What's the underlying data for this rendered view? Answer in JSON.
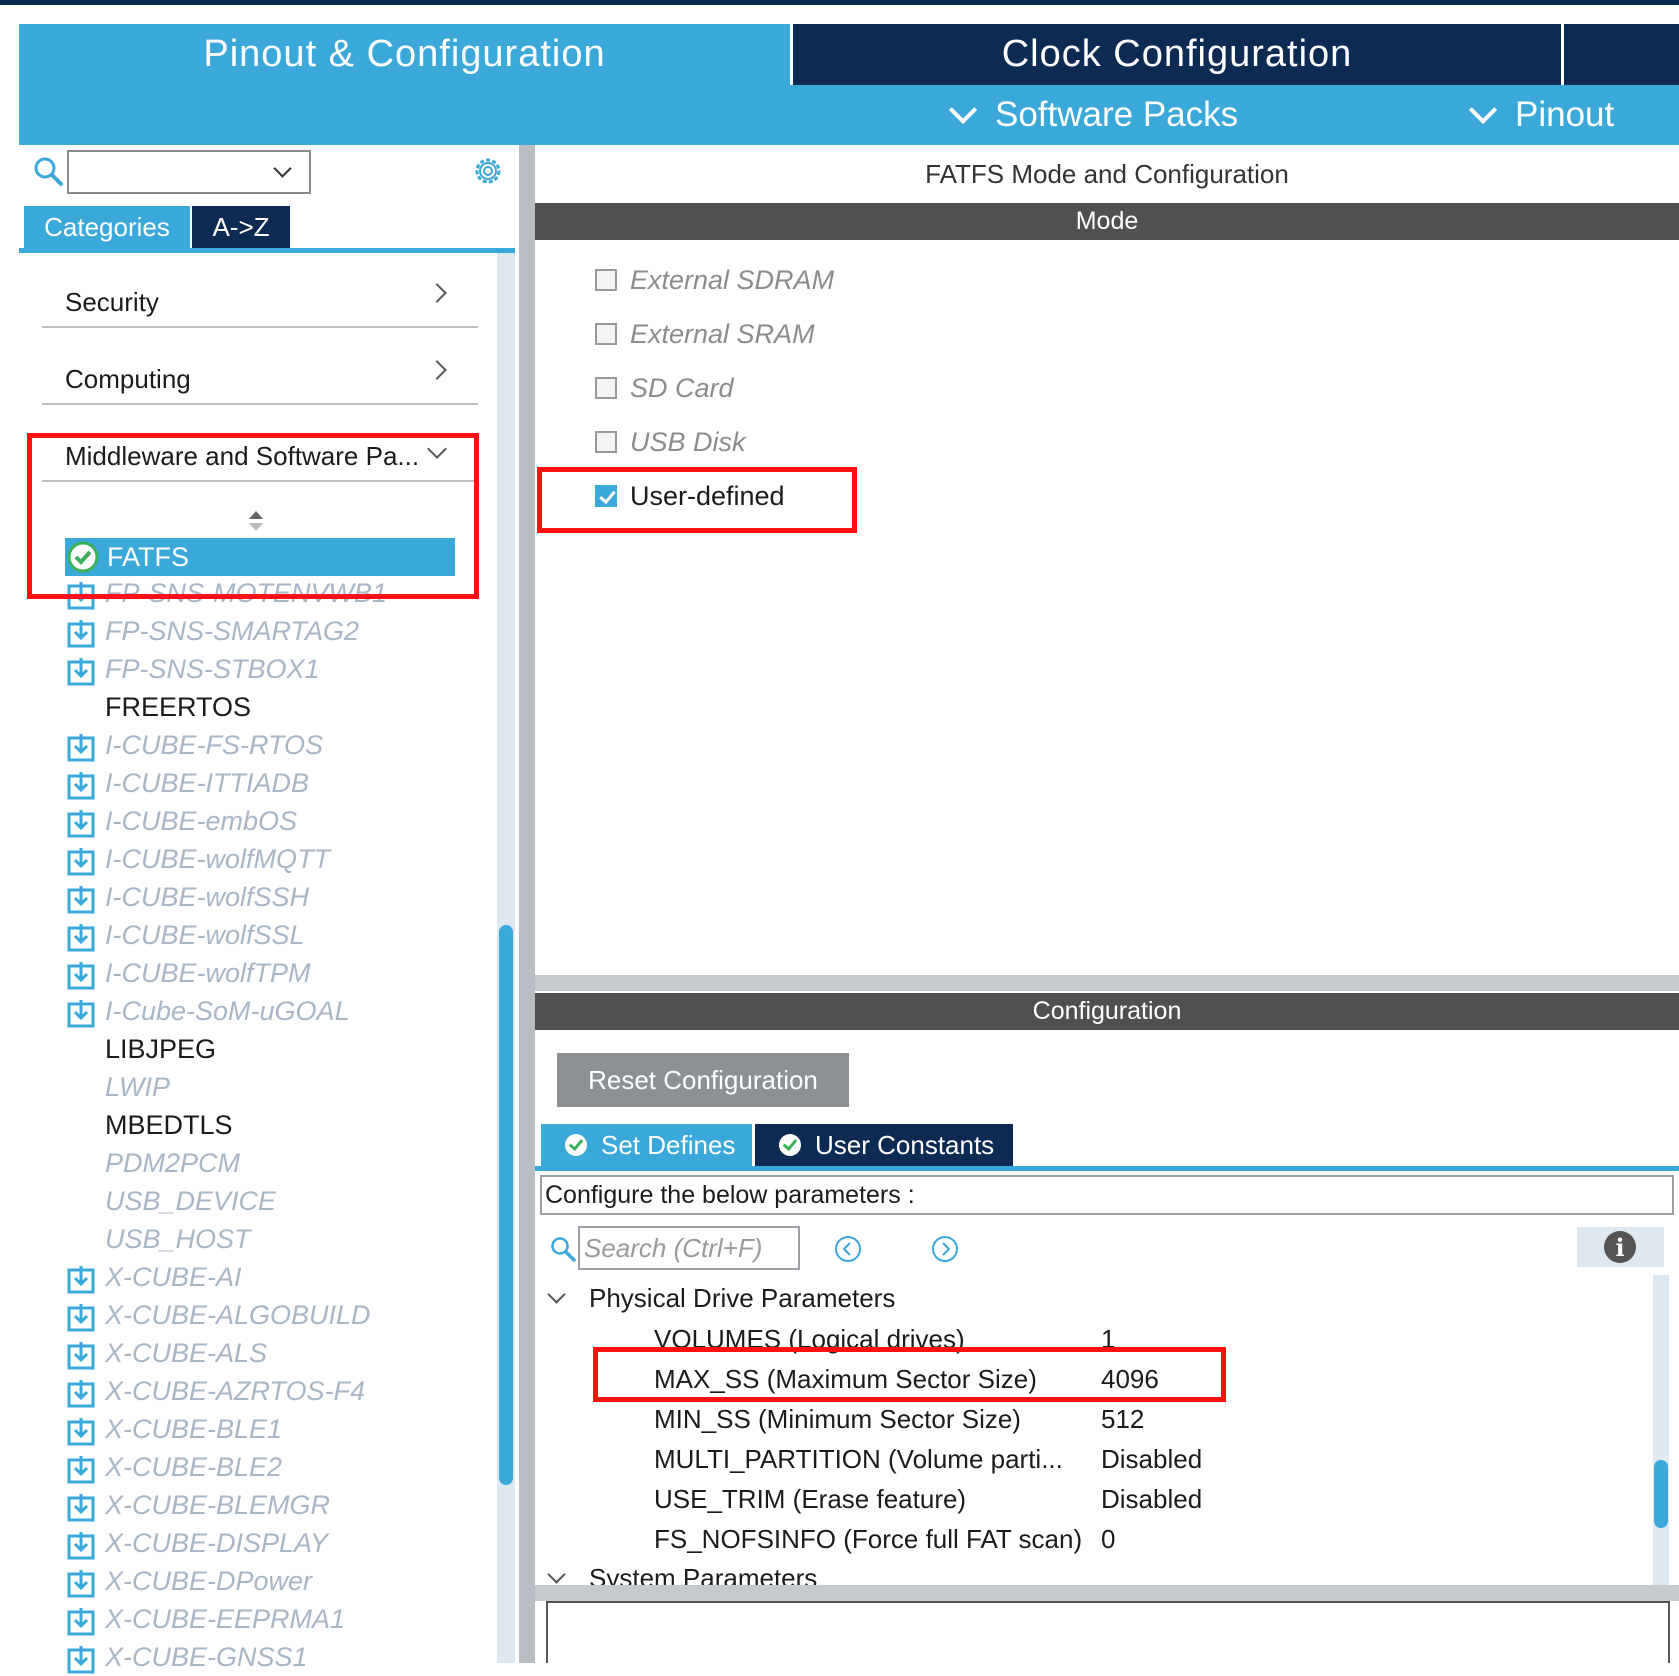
{
  "header": {
    "tabs": [
      {
        "label": "Pinout & Configuration",
        "active": true
      },
      {
        "label": "Clock Configuration",
        "active": false
      }
    ],
    "subbar": {
      "software_packs": "Software Packs",
      "pinout": "Pinout"
    }
  },
  "left_panel": {
    "search": {
      "value": ""
    },
    "view_tabs": {
      "categories": "Categories",
      "az": "A->Z"
    },
    "categories": [
      {
        "label": "Security",
        "expanded": false
      },
      {
        "label": "Computing",
        "expanded": false
      },
      {
        "label": "Middleware and Software Pa...",
        "expanded": true
      }
    ],
    "middleware_items": [
      {
        "label": "FATFS",
        "state": "selected",
        "icon": "check-circle-icon"
      },
      {
        "label": "FP-SNS-MOTENVWB1",
        "state": "disabled",
        "icon": "download-icon"
      },
      {
        "label": "FP-SNS-SMARTAG2",
        "state": "disabled",
        "icon": "download-icon"
      },
      {
        "label": "FP-SNS-STBOX1",
        "state": "disabled",
        "icon": "download-icon"
      },
      {
        "label": "FREERTOS",
        "state": "enabled",
        "icon": ""
      },
      {
        "label": "I-CUBE-FS-RTOS",
        "state": "disabled",
        "icon": "download-icon"
      },
      {
        "label": "I-CUBE-ITTIADB",
        "state": "disabled",
        "icon": "download-icon"
      },
      {
        "label": "I-CUBE-embOS",
        "state": "disabled",
        "icon": "download-icon"
      },
      {
        "label": "I-CUBE-wolfMQTT",
        "state": "disabled",
        "icon": "download-icon"
      },
      {
        "label": "I-CUBE-wolfSSH",
        "state": "disabled",
        "icon": "download-icon"
      },
      {
        "label": "I-CUBE-wolfSSL",
        "state": "disabled",
        "icon": "download-icon"
      },
      {
        "label": "I-CUBE-wolfTPM",
        "state": "disabled",
        "icon": "download-icon"
      },
      {
        "label": "I-Cube-SoM-uGOAL",
        "state": "disabled",
        "icon": "download-icon"
      },
      {
        "label": "LIBJPEG",
        "state": "enabled",
        "icon": ""
      },
      {
        "label": "LWIP",
        "state": "disabled",
        "icon": ""
      },
      {
        "label": "MBEDTLS",
        "state": "enabled",
        "icon": ""
      },
      {
        "label": "PDM2PCM",
        "state": "disabled",
        "icon": ""
      },
      {
        "label": "USB_DEVICE",
        "state": "disabled",
        "icon": ""
      },
      {
        "label": "USB_HOST",
        "state": "disabled",
        "icon": ""
      },
      {
        "label": "X-CUBE-AI",
        "state": "disabled",
        "icon": "download-icon"
      },
      {
        "label": "X-CUBE-ALGOBUILD",
        "state": "disabled",
        "icon": "download-icon"
      },
      {
        "label": "X-CUBE-ALS",
        "state": "disabled",
        "icon": "download-icon"
      },
      {
        "label": "X-CUBE-AZRTOS-F4",
        "state": "disabled",
        "icon": "download-icon"
      },
      {
        "label": "X-CUBE-BLE1",
        "state": "disabled",
        "icon": "download-icon"
      },
      {
        "label": "X-CUBE-BLE2",
        "state": "disabled",
        "icon": "download-icon"
      },
      {
        "label": "X-CUBE-BLEMGR",
        "state": "disabled",
        "icon": "download-icon"
      },
      {
        "label": "X-CUBE-DISPLAY",
        "state": "disabled",
        "icon": "download-icon"
      },
      {
        "label": "X-CUBE-DPower",
        "state": "disabled",
        "icon": "download-icon"
      },
      {
        "label": "X-CUBE-EEPRMA1",
        "state": "disabled",
        "icon": "download-icon"
      },
      {
        "label": "X-CUBE-GNSS1",
        "state": "disabled",
        "icon": "download-icon"
      }
    ]
  },
  "mode_panel": {
    "title": "FATFS Mode and Configuration",
    "mode_header": "Mode",
    "options": [
      {
        "label": "External SDRAM",
        "checked": false,
        "enabled": false
      },
      {
        "label": "External SRAM",
        "checked": false,
        "enabled": false
      },
      {
        "label": "SD Card",
        "checked": false,
        "enabled": false
      },
      {
        "label": "USB Disk",
        "checked": false,
        "enabled": false
      },
      {
        "label": "User-defined",
        "checked": true,
        "enabled": true
      }
    ]
  },
  "config_panel": {
    "header": "Configuration",
    "reset_label": "Reset Configuration",
    "tabs": [
      {
        "label": "Set Defines",
        "active": true
      },
      {
        "label": "User Constants",
        "active": false
      }
    ],
    "info_text": "Configure the below parameters :",
    "search_placeholder": "Search (Ctrl+F)",
    "groups": [
      {
        "name": "Physical Drive Parameters",
        "params": [
          {
            "name": "VOLUMES (Logical drives)",
            "value": "1"
          },
          {
            "name": "MAX_SS (Maximum Sector Size)",
            "value": "4096"
          },
          {
            "name": "MIN_SS (Minimum Sector Size)",
            "value": "512"
          },
          {
            "name": "MULTI_PARTITION (Volume parti...",
            "value": "Disabled"
          },
          {
            "name": "USE_TRIM (Erase feature)",
            "value": "Disabled"
          },
          {
            "name": "FS_NOFSINFO (Force full FAT scan)",
            "value": "0"
          }
        ]
      },
      {
        "name": "System Parameters",
        "params": []
      }
    ]
  },
  "colors": {
    "accent": "#3ba8da",
    "dark_navy": "#0d2b52",
    "section_header": "#505050",
    "annotation_red": "#ff1111"
  }
}
